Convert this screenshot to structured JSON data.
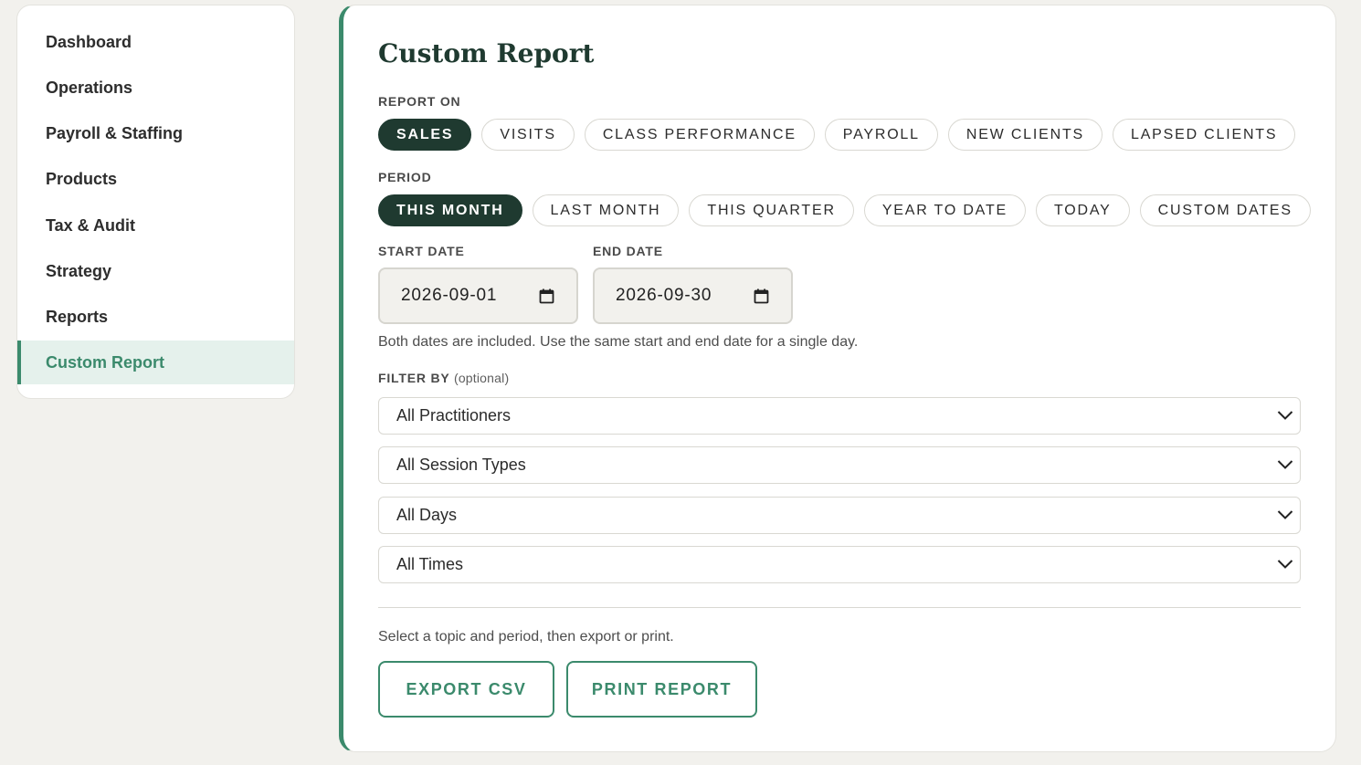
{
  "sidebar": {
    "items": [
      {
        "label": "Dashboard"
      },
      {
        "label": "Operations"
      },
      {
        "label": "Payroll & Staffing"
      },
      {
        "label": "Products"
      },
      {
        "label": "Tax & Audit"
      },
      {
        "label": "Strategy"
      },
      {
        "label": "Reports"
      },
      {
        "label": "Custom Report"
      }
    ],
    "active_label": "Custom Report"
  },
  "main": {
    "title": "Custom Report",
    "report_on": {
      "label": "REPORT ON",
      "options": [
        "SALES",
        "VISITS",
        "CLASS PERFORMANCE",
        "PAYROLL",
        "NEW CLIENTS",
        "LAPSED CLIENTS"
      ],
      "selected": "SALES"
    },
    "period": {
      "label": "PERIOD",
      "options": [
        "THIS MONTH",
        "LAST MONTH",
        "THIS QUARTER",
        "YEAR TO DATE",
        "TODAY",
        "CUSTOM DATES"
      ],
      "selected": "THIS MONTH"
    },
    "start_date": {
      "label": "START DATE",
      "value": "2026-09-01"
    },
    "end_date": {
      "label": "END DATE",
      "value": "2026-09-30"
    },
    "dates_helper": "Both dates are included. Use the same start and end date for a single day.",
    "filter": {
      "label": "FILTER BY",
      "optional": "(optional)",
      "practitioners": "All Practitioners",
      "session_types": "All Session Types",
      "days": "All Days",
      "times": "All Times"
    },
    "footer_helper": "Select a topic and period, then export or print.",
    "export_label": "EXPORT CSV",
    "print_label": "PRINT REPORT"
  },
  "colors": {
    "accent": "#3b8a6c",
    "dark": "#1f3a30",
    "background": "#f2f1ed",
    "active_nav_bg": "#e5f1ec"
  },
  "icons": {
    "calendar": "calendar-icon",
    "dropdown": "chevron-down-icon"
  }
}
